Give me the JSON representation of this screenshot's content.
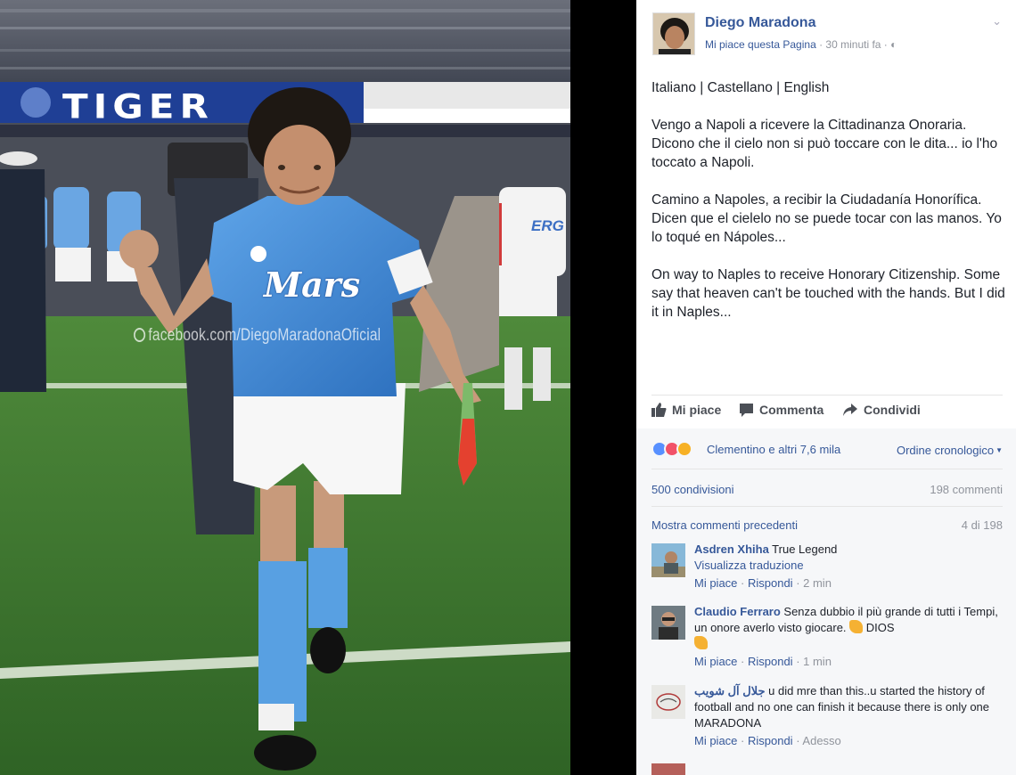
{
  "photo": {
    "banner_text": "TIGER",
    "shirt_sponsor": "Mars",
    "opponent_sponsor": "ERG",
    "watermark": "facebook.com/DiegoMaradonaOficial"
  },
  "post": {
    "author": "Diego Maradona",
    "like_page": "Mi piace questa Pagina",
    "time": "30 minuti fa",
    "sep1": " · ",
    "sep2": " · ",
    "languages": "Italiano | Castellano | English",
    "italian_text": "Vengo a Napoli a ricevere la Cittadinanza Onoraria. Dicono che il cielo non si può toccare con le dita... io l'ho toccato a Napoli.",
    "spanish_text": "Camino a Napoles, a recibir la Ciudadanía Honorífica. Dicen que el cielelo no se puede tocar con las manos. Yo lo toqué en Nápoles...",
    "english_text": "On way to Naples to receive Honorary Citizenship. Some say that heaven can't be touched with the hands. But I did it in Naples..."
  },
  "actions": {
    "like": "Mi piace",
    "comment": "Commenta",
    "share": "Condividi"
  },
  "feedback": {
    "reactions_text": "Clementino e altri 7,6 mila",
    "order": "Ordine cronologico",
    "shares": "500 condivisioni",
    "comments_count": "198 commenti",
    "show_previous": "Mostra commenti precedenti",
    "page_count": "4 di 198"
  },
  "comments": [
    {
      "name": "Asdren Xhiha",
      "text": " True Legend",
      "translate": "Visualizza traduzione",
      "like": "Mi piace",
      "reply": "Rispondi",
      "time": "2 min"
    },
    {
      "name": "Claudio Ferraro",
      "text": " Senza dubbio il più grande di tutti i Tempi, un onore averlo visto giocare. ",
      "text2": " DIOS",
      "like": "Mi piace",
      "reply": "Rispondi",
      "time": "1 min"
    },
    {
      "name": "جلال آل شويب",
      "text": " u did mre than this..u started the history of football and no one can finish it because there is only one MARADONA",
      "like": "Mi piace",
      "reply": "Rispondi",
      "time": "Adesso"
    }
  ],
  "colors": {
    "link": "#365899",
    "meta": "#90949c",
    "like_reaction": "#5890ff",
    "love_reaction": "#f25268",
    "haha_reaction": "#f7b125",
    "napoli_blue": "#4a8fd6"
  }
}
